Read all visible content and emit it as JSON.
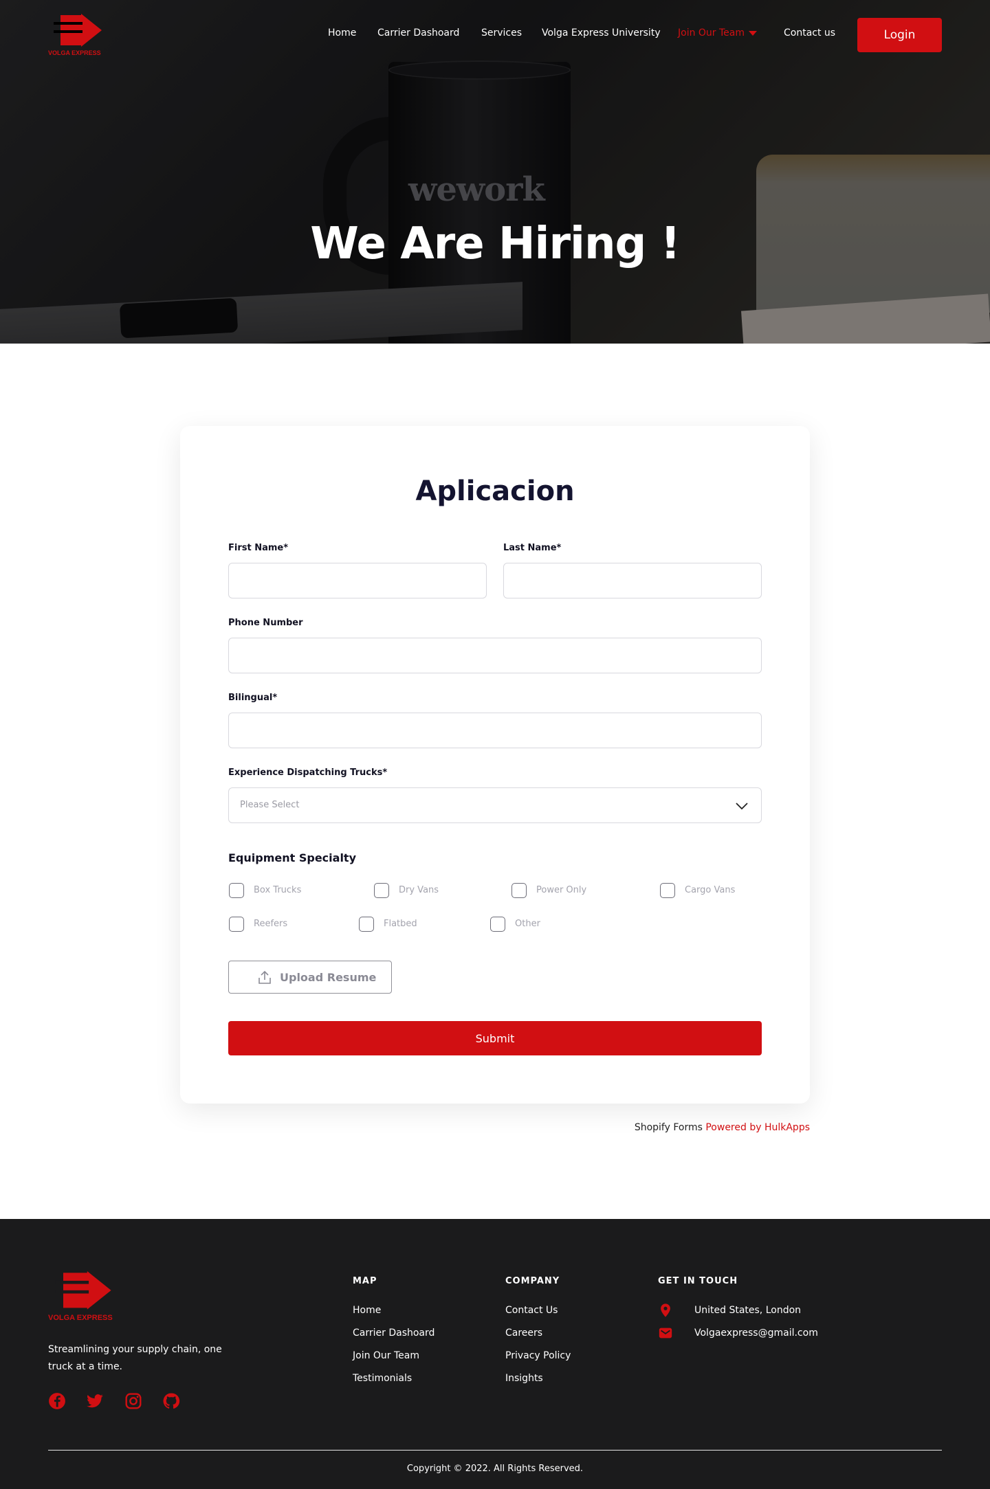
{
  "brand": {
    "name": "VOLGA EXPRESS",
    "accent_color": "#d10f12"
  },
  "nav": {
    "items": [
      {
        "label": "Home"
      },
      {
        "label": "Carrier Dashoard"
      },
      {
        "label": "Services"
      },
      {
        "label": "Volga Express University"
      },
      {
        "label": "Join Our Team",
        "active": true,
        "has_dropdown": true
      },
      {
        "label": "Contact us"
      }
    ],
    "login_label": "Login"
  },
  "hero": {
    "title": "We Are Hiring !",
    "mug_brand": "wework"
  },
  "form": {
    "title": "Aplicacion",
    "first_name_label": "First Name*",
    "last_name_label": "Last Name*",
    "phone_label": "Phone Number",
    "bilingual_label": "Bilingual*",
    "experience_label": "Experience Dispatching Trucks*",
    "experience_placeholder": "Please Select",
    "equipment_title": "Equipment Specialty",
    "equipment_options": [
      "Box Trucks",
      "Dry Vans",
      "Power Only",
      "Cargo Vans",
      "Reefers",
      "Flatbed",
      "Other"
    ],
    "upload_label": "Upload Resume",
    "submit_label": "Submit"
  },
  "powered_by": {
    "prefix": "Shopify Forms",
    "link": "Powered by HulkApps"
  },
  "footer": {
    "tagline": "Streamlining your supply chain, one truck at a time.",
    "social_icons": [
      "facebook-icon",
      "twitter-icon",
      "instagram-icon",
      "github-icon"
    ],
    "map": {
      "heading": "MAP",
      "links": [
        "Home",
        "Carrier Dashoard",
        "Join Our Team",
        "Testimonials"
      ]
    },
    "company": {
      "heading": "COMPANY",
      "links": [
        "Contact Us",
        "Careers",
        "Privacy Policy",
        "Insights"
      ]
    },
    "contact": {
      "heading": "GET IN TOUCH",
      "location": "United States, London",
      "email": "Volgaexpress@gmail.com"
    },
    "copyright": "Copyright © 2022. All Rights Reserved."
  }
}
